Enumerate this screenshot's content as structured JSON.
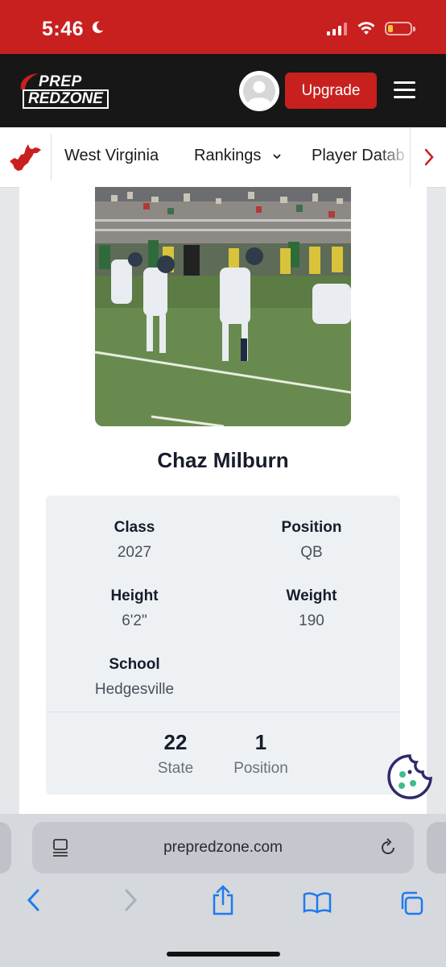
{
  "status_bar": {
    "time": "5:46",
    "moon_icon": "moon-icon",
    "signal_icon": "cellular-signal-icon",
    "wifi_icon": "wifi-icon",
    "battery_icon": "battery-low-icon",
    "background": "#c8201f"
  },
  "header": {
    "logo_line1": "PREP",
    "logo_line2": "REDZONE",
    "upgrade_label": "Upgrade",
    "menu_icon": "hamburger-menu-icon",
    "avatar_icon": "user-avatar-icon",
    "brand_red": "#c8201f",
    "background": "#171717"
  },
  "nav": {
    "state_icon": "west-virginia-map-icon",
    "items": [
      {
        "label": "West Virginia"
      },
      {
        "label": "Rankings"
      },
      {
        "label": "Player Datab"
      }
    ],
    "more_icon": "chevron-right-icon"
  },
  "player": {
    "name": "Chaz Milburn",
    "photo_alt": "football-action-photo",
    "details": [
      {
        "label": "Class",
        "value": "2027"
      },
      {
        "label": "Position",
        "value": "QB"
      },
      {
        "label": "Height",
        "value": "6'2\""
      },
      {
        "label": "Weight",
        "value": "190"
      },
      {
        "label": "School",
        "value": "Hedgesville"
      }
    ],
    "rankings": [
      {
        "rank": "22",
        "label": "State"
      },
      {
        "rank": "1",
        "label": "Position"
      }
    ]
  },
  "cookie_button": {
    "icon": "cookie-icon",
    "color": "#2f2a6b"
  },
  "safari": {
    "url": "prepredzone.com",
    "page_menu_icon": "page-format-icon",
    "reload_icon": "reload-icon",
    "back_icon": "back-arrow-icon",
    "forward_icon": "forward-arrow-icon",
    "share_icon": "share-icon",
    "bookmarks_icon": "bookmarks-book-icon",
    "tabs_icon": "tabs-icon",
    "accent": "#1f7aef"
  }
}
